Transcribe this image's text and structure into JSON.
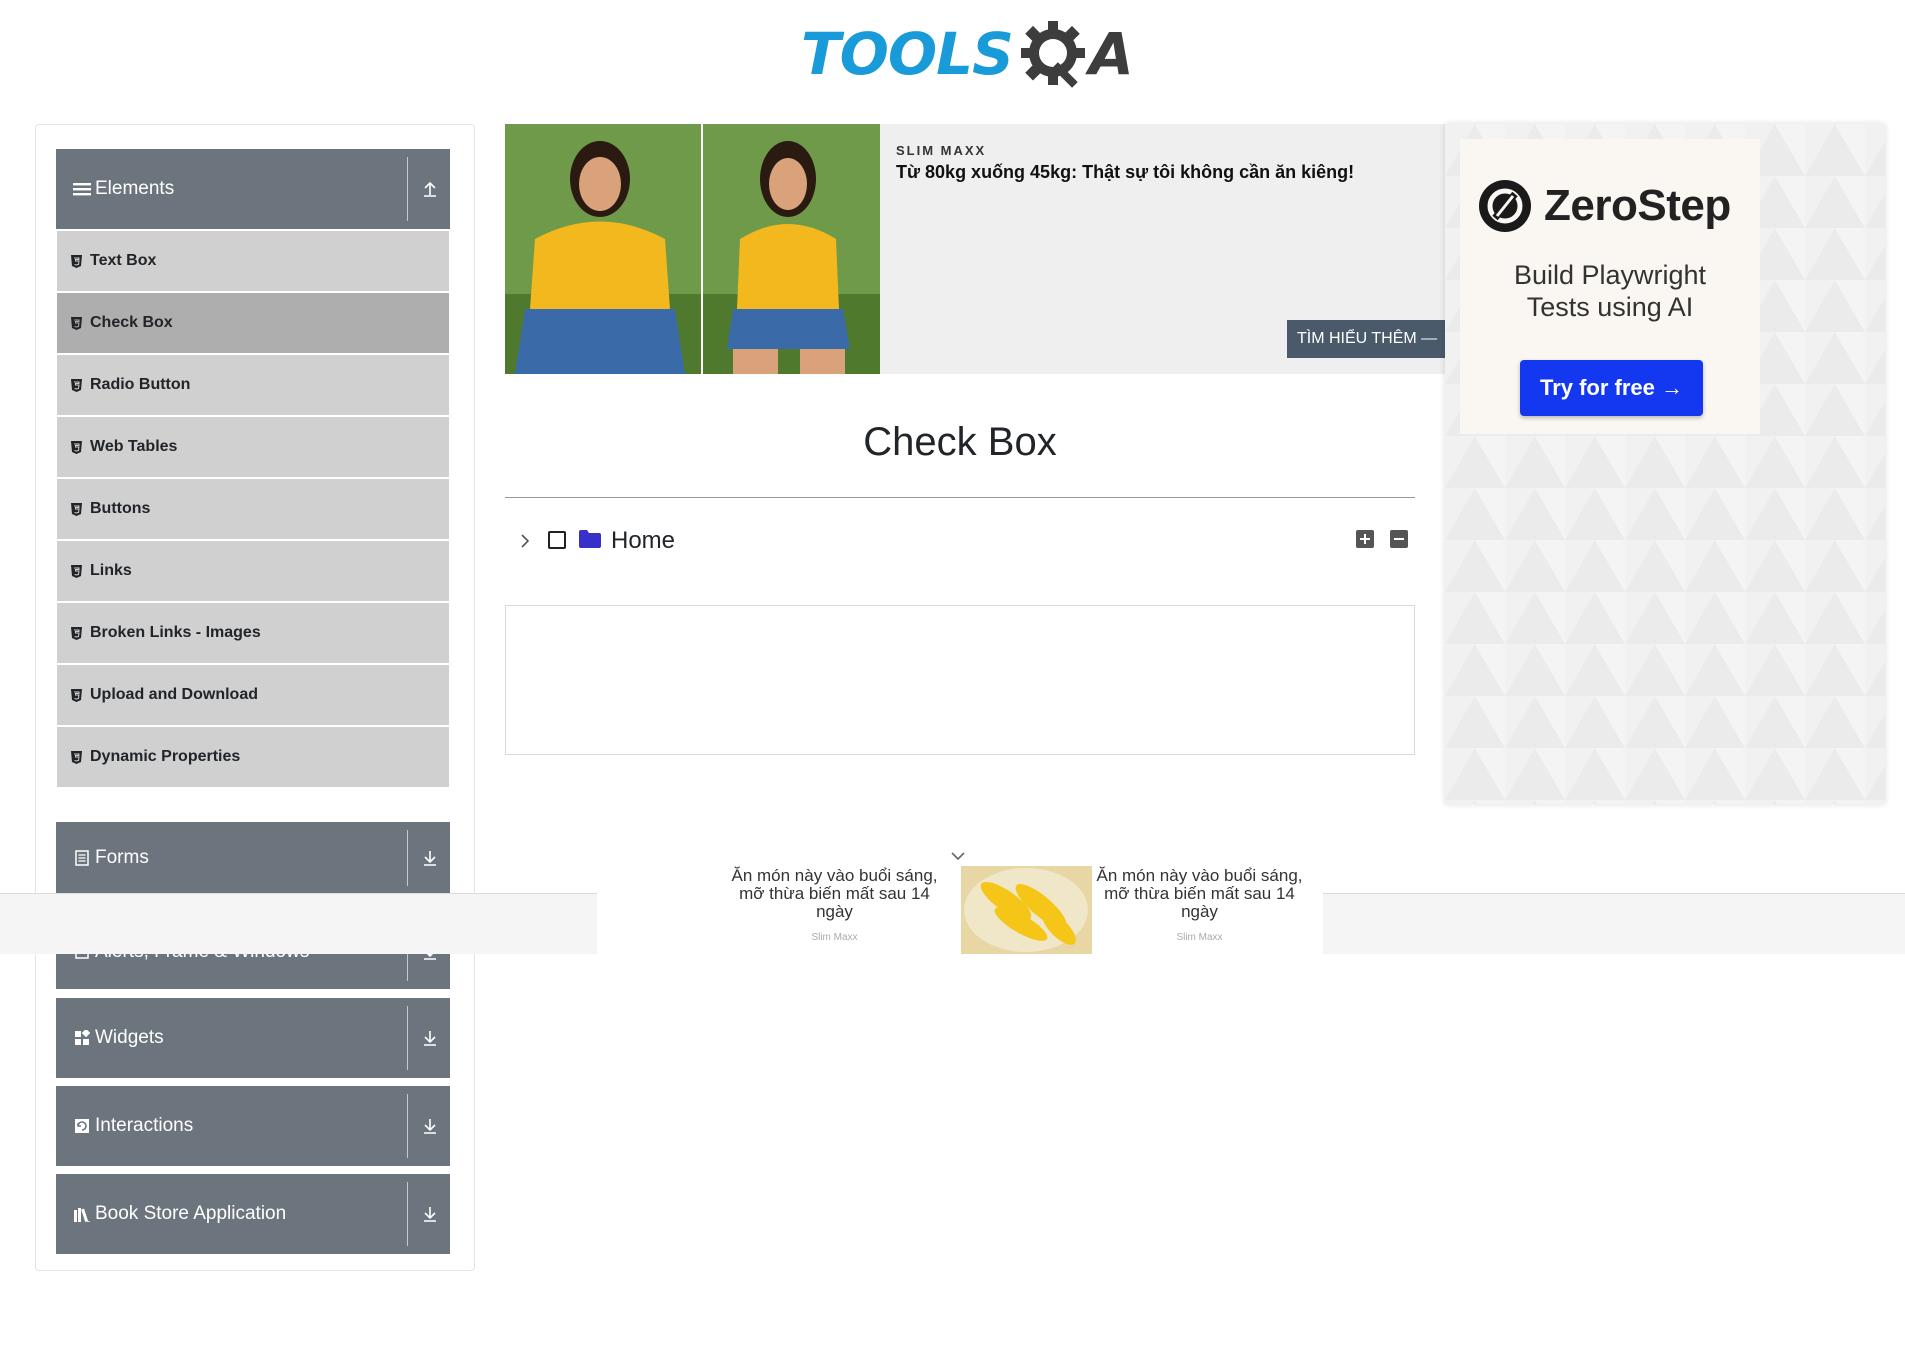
{
  "brand": {
    "tools": "TOOLS",
    "a": "A"
  },
  "sidebar": {
    "groups": [
      {
        "title": "Elements",
        "icon": "hamburger-icon",
        "arrow": "up-arrow-icon"
      },
      {
        "title": "Forms",
        "icon": "form-icon",
        "arrow": "down-arrow-icon"
      },
      {
        "title": "Alerts, Frame & Windows",
        "icon": "alert-icon",
        "arrow": "down-arrow-icon"
      },
      {
        "title": "Widgets",
        "icon": "widgets-icon",
        "arrow": "down-arrow-icon"
      },
      {
        "title": "Interactions",
        "icon": "interactions-icon",
        "arrow": "down-arrow-icon"
      },
      {
        "title": "Book Store Application",
        "icon": "books-icon",
        "arrow": "down-arrow-icon"
      }
    ],
    "elements_items": [
      {
        "label": "Text Box"
      },
      {
        "label": "Check Box",
        "active": true
      },
      {
        "label": "Radio Button"
      },
      {
        "label": "Web Tables"
      },
      {
        "label": "Buttons"
      },
      {
        "label": "Links"
      },
      {
        "label": "Broken Links - Images"
      },
      {
        "label": "Upload and Download"
      },
      {
        "label": "Dynamic Properties"
      }
    ]
  },
  "top_ad": {
    "brand": "SLIM MAXX",
    "headline": "Từ 80kg xuống 45kg: Thật sự tôi không cần ăn kiêng!",
    "cta": "TÌM HIỂU THÊM —"
  },
  "right_ad": {
    "name": "ZeroStep",
    "tagline_line1": "Build Playwright",
    "tagline_line2": "Tests using AI",
    "cta": "Try for free →"
  },
  "main": {
    "title": "Check Box",
    "tree": {
      "root_label": "Home"
    }
  },
  "strip_ad": {
    "left_text": "Ăn món này vào buổi sáng, mỡ thừa biến mất sau 14 ngày",
    "left_source": "Slim Maxx",
    "right_text": "Ăn món này vào buổi sáng, mỡ thừa biến mất sau 14 ngày",
    "right_source": "Slim Maxx"
  },
  "colors": {
    "accent_blue": "#189bd8",
    "sidebar_header": "#6c757d",
    "menu_item": "#d0d0d0",
    "menu_active": "#aeaeae",
    "zerostep_button": "#1338f0",
    "folder": "#3730c9"
  }
}
